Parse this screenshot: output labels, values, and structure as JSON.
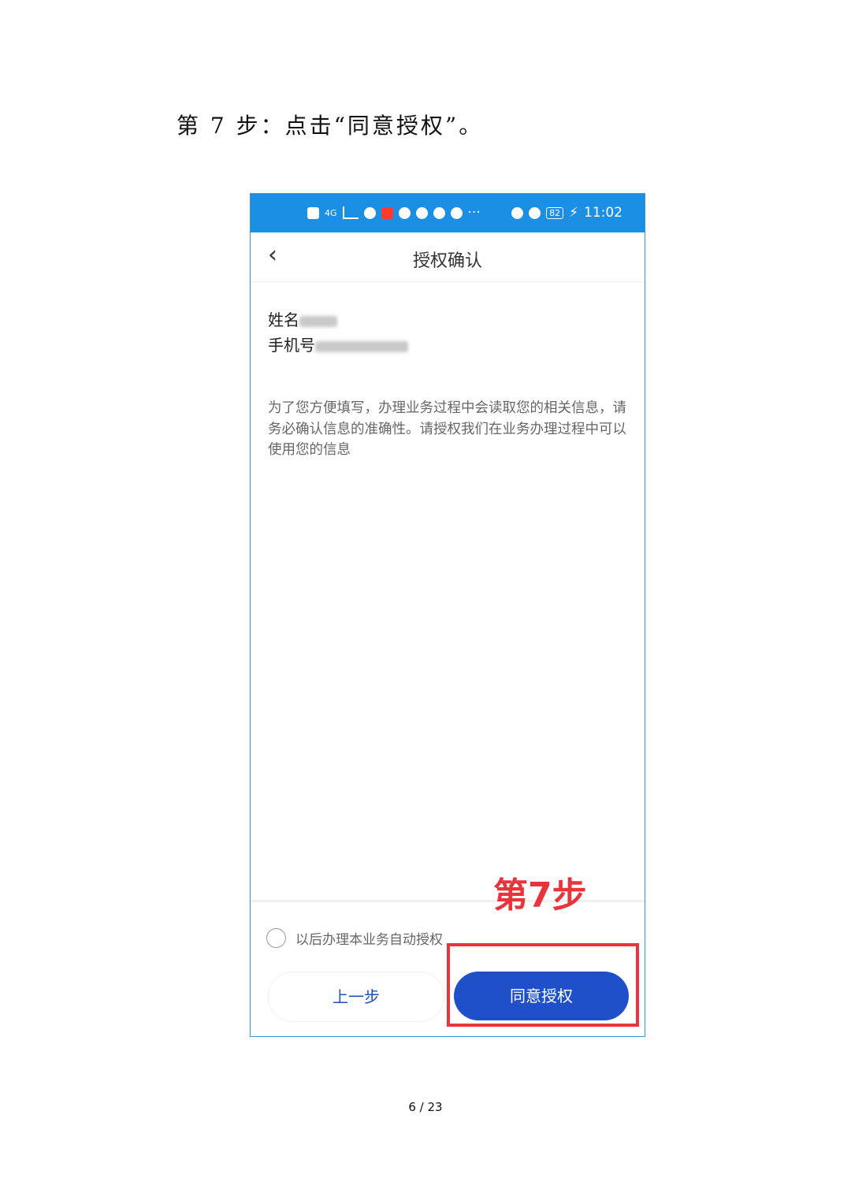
{
  "doc": {
    "step_heading": "第 7 步：点击“同意授权”。",
    "annotation_label": "第7步",
    "page_number": "6 / 23"
  },
  "phone": {
    "status_bar": {
      "time": "11:02",
      "battery": "82",
      "network": "4G"
    },
    "title": "授权确认",
    "back_icon": "chevron-left",
    "name_label": "姓名",
    "phone_label": "手机号",
    "description": "为了您方便填写，办理业务过程中会读取您的相关信息，请务必确认信息的准确性。请授权我们在业务办理过程中可以使用您的信息",
    "auto_auth_label": "以后办理本业务自动授权",
    "prev_button": "上一步",
    "agree_button": "同意授权"
  },
  "colors": {
    "status_bar": "#1a8fe3",
    "agree_button": "#1f4fc9",
    "annotation": "#e8343a"
  }
}
